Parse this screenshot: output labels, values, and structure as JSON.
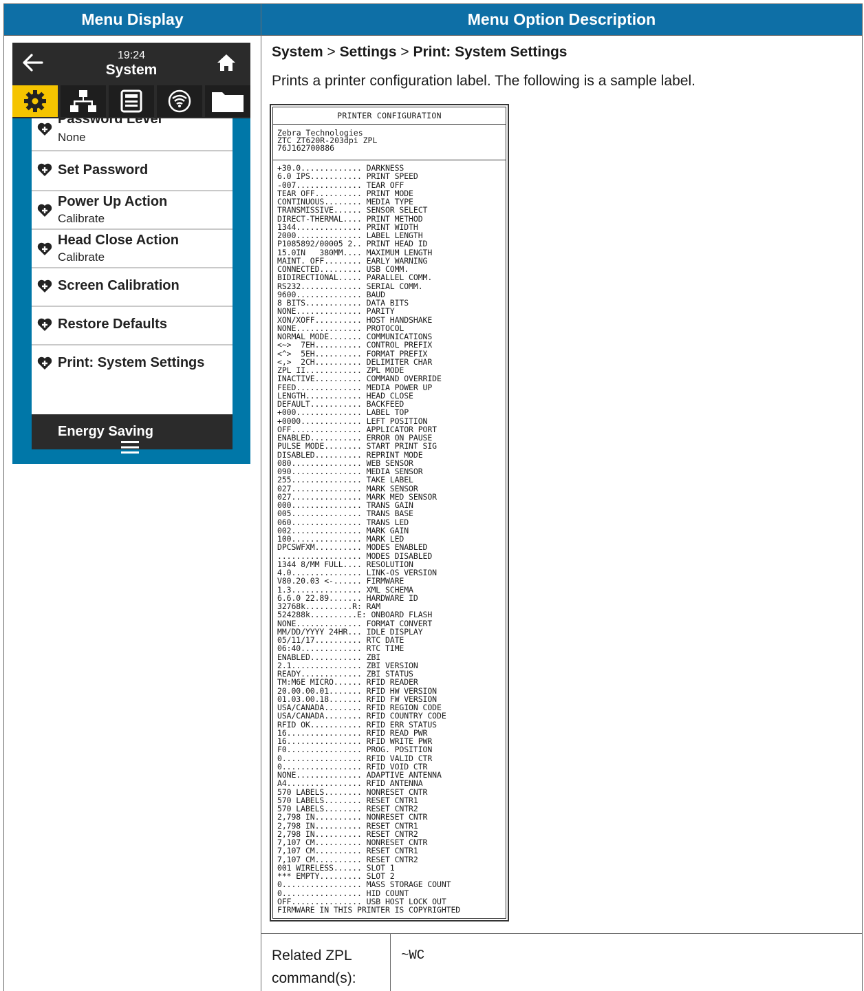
{
  "table": {
    "col1_header": "Menu Display",
    "col2_header": "Menu Option Description"
  },
  "device": {
    "time": "19:24",
    "title": "System",
    "tabs": [
      "gear-icon",
      "network-icon",
      "printer-icon",
      "wireless-icon",
      "folder-icon"
    ],
    "items": [
      {
        "label": "Password Level",
        "sub": "None"
      },
      {
        "label": "Set Password",
        "sub": ""
      },
      {
        "label": "Power Up Action",
        "sub": "Calibrate"
      },
      {
        "label": "Head Close Action",
        "sub": "Calibrate"
      },
      {
        "label": "Screen Calibration",
        "sub": ""
      },
      {
        "label": "Restore Defaults",
        "sub": ""
      },
      {
        "label": "Print: System Settings",
        "sub": ""
      }
    ],
    "energy_label": "Energy Saving",
    "colors": {
      "bar": "#2b2b2b",
      "accent": "#f5c400",
      "bg": "#0077a8"
    }
  },
  "description": {
    "path_1": "System",
    "sep_1": " > ",
    "path_2": "Settings",
    "sep_2": " > ",
    "path_3": "Print: System Settings",
    "text": "Prints a printer configuration label. The following is a sample label."
  },
  "config_label": {
    "heading": "PRINTER CONFIGURATION",
    "header_lines": [
      "Zebra Technologies",
      "ZTC ZT620R-203dpi ZPL",
      "76J162700886"
    ],
    "rows": [
      [
        "+30.0",
        "DARKNESS"
      ],
      [
        "6.0 IPS",
        "PRINT SPEED"
      ],
      [
        "-007",
        "TEAR OFF"
      ],
      [
        "TEAR OFF",
        "PRINT MODE"
      ],
      [
        "CONTINUOUS",
        "MEDIA TYPE"
      ],
      [
        "TRANSMISSIVE",
        "SENSOR SELECT"
      ],
      [
        "DIRECT-THERMAL",
        "PRINT METHOD"
      ],
      [
        "1344",
        "PRINT WIDTH"
      ],
      [
        "2000",
        "LABEL LENGTH"
      ],
      [
        "P1085892/00005 2",
        "PRINT HEAD ID"
      ],
      [
        "15.0IN   380MM",
        "MAXIMUM LENGTH"
      ],
      [
        "MAINT. OFF",
        "EARLY WARNING"
      ],
      [
        "CONNECTED",
        "USB COMM."
      ],
      [
        "BIDIRECTIONAL",
        "PARALLEL COMM."
      ],
      [
        "RS232",
        "SERIAL COMM."
      ],
      [
        "9600",
        "BAUD"
      ],
      [
        "8 BITS",
        "DATA BITS"
      ],
      [
        "NONE",
        "PARITY"
      ],
      [
        "XON/XOFF",
        "HOST HANDSHAKE"
      ],
      [
        "NONE",
        "PROTOCOL"
      ],
      [
        "NORMAL MODE",
        "COMMUNICATIONS"
      ],
      [
        "<~>  7EH",
        "CONTROL PREFIX"
      ],
      [
        "<^>  5EH",
        "FORMAT PREFIX"
      ],
      [
        "<,>  2CH",
        "DELIMITER CHAR"
      ],
      [
        "ZPL II",
        "ZPL MODE"
      ],
      [
        "INACTIVE",
        "COMMAND OVERRIDE"
      ],
      [
        "FEED",
        "MEDIA POWER UP"
      ],
      [
        "LENGTH",
        "HEAD CLOSE"
      ],
      [
        "DEFAULT",
        "BACKFEED"
      ],
      [
        "+000",
        "LABEL TOP"
      ],
      [
        "+0000",
        "LEFT POSITION"
      ],
      [
        "OFF",
        "APPLICATOR PORT"
      ],
      [
        "ENABLED",
        "ERROR ON PAUSE"
      ],
      [
        "PULSE MODE",
        "START PRINT SIG"
      ],
      [
        "DISABLED",
        "REPRINT MODE"
      ],
      [
        "080",
        "WEB SENSOR"
      ],
      [
        "090",
        "MEDIA SENSOR"
      ],
      [
        "255",
        "TAKE LABEL"
      ],
      [
        "027",
        "MARK SENSOR"
      ],
      [
        "027",
        "MARK MED SENSOR"
      ],
      [
        "000",
        "TRANS GAIN"
      ],
      [
        "005",
        "TRANS BASE"
      ],
      [
        "060",
        "TRANS LED"
      ],
      [
        "002",
        "MARK GAIN"
      ],
      [
        "100",
        "MARK LED"
      ],
      [
        "DPCSWFXM",
        "MODES ENABLED"
      ],
      [
        "",
        "MODES DISABLED"
      ],
      [
        "1344 8/MM FULL",
        "RESOLUTION"
      ],
      [
        "4.0",
        "LINK-OS VERSION"
      ],
      [
        "V80.20.03 <-",
        "FIRMWARE"
      ],
      [
        "1.3",
        "XML SCHEMA"
      ],
      [
        "6.6.0 22.89",
        "HARDWARE ID"
      ],
      [
        "32768k..........R:",
        "RAM"
      ],
      [
        "524288k..........E:",
        "ONBOARD FLASH"
      ],
      [
        "NONE",
        "FORMAT CONVERT"
      ],
      [
        "MM/DD/YYYY 24HR",
        "IDLE DISPLAY"
      ],
      [
        "05/11/17",
        "RTC DATE"
      ],
      [
        "06:40",
        "RTC TIME"
      ],
      [
        "ENABLED",
        "ZBI"
      ],
      [
        "2.1",
        "ZBI VERSION"
      ],
      [
        "READY",
        "ZBI STATUS"
      ],
      [
        "TM:M6E MICRO",
        "RFID READER"
      ],
      [
        "20.00.00.01",
        "RFID HW VERSION"
      ],
      [
        "01.03.00.18",
        "RFID FW VERSION"
      ],
      [
        "USA/CANADA",
        "RFID REGION CODE"
      ],
      [
        "USA/CANADA",
        "RFID COUNTRY CODE"
      ],
      [
        "RFID OK",
        "RFID ERR STATUS"
      ],
      [
        "16",
        "RFID READ PWR"
      ],
      [
        "16",
        "RFID WRITE PWR"
      ],
      [
        "F0",
        "PROG. POSITION"
      ],
      [
        "0",
        "RFID VALID CTR"
      ],
      [
        "0",
        "RFID VOID CTR"
      ],
      [
        "NONE",
        "ADAPTIVE ANTENNA"
      ],
      [
        "A4",
        "RFID ANTENNA"
      ],
      [
        "570 LABELS",
        "NONRESET CNTR"
      ],
      [
        "570 LABELS",
        "RESET CNTR1"
      ],
      [
        "570 LABELS",
        "RESET CNTR2"
      ],
      [
        "2,798 IN",
        "NONRESET CNTR"
      ],
      [
        "2,798 IN",
        "RESET CNTR1"
      ],
      [
        "2,798 IN",
        "RESET CNTR2"
      ],
      [
        "7,107 CM",
        "NONRESET CNTR"
      ],
      [
        "7,107 CM",
        "RESET CNTR1"
      ],
      [
        "7,107 CM",
        "RESET CNTR2"
      ],
      [
        "001 WIRELESS",
        "SLOT 1"
      ],
      [
        "*** EMPTY",
        "SLOT 2"
      ],
      [
        "0",
        "MASS STORAGE COUNT"
      ],
      [
        "0",
        "HID COUNT"
      ],
      [
        "OFF",
        "USB HOST LOCK OUT"
      ]
    ],
    "footer": "FIRMWARE IN THIS PRINTER IS COPYRIGHTED"
  },
  "related": {
    "label": "Related ZPL command(s):",
    "label_line1": "Related ZPL",
    "label_line2": "command(s):",
    "value": "~WC"
  }
}
